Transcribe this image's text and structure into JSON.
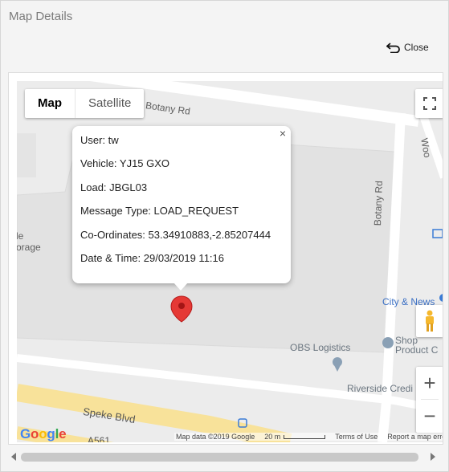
{
  "window": {
    "title": "Map Details",
    "close_label": "Close"
  },
  "map_controls": {
    "map_label": "Map",
    "satellite_label": "Satellite",
    "zoom_in": "+",
    "zoom_out": "−"
  },
  "info_window": {
    "rows": [
      "User: tw",
      "Vehicle: YJ15 GXO",
      "Load: JBGL03",
      "Message Type: LOAD_REQUEST",
      "Co-Ordinates: 53.34910883,-2.85207444",
      "Date & Time: 29/03/2019 11:16"
    ],
    "close_glyph": "×"
  },
  "map_labels": {
    "botany_rd_top": "Botany Rd",
    "botany_rd_side": "Botany Rd",
    "storage": "orage",
    "storage_prefix": "le",
    "city_news": "City & News",
    "obs_logistics": "OBS Logistics",
    "shop": "Shop",
    "product": "Product C",
    "riverside": "Riverside Credi",
    "speke_blvd": "Speke Blvd",
    "a561": "A561",
    "woo": "Woo"
  },
  "attribution": {
    "map_data": "Map data ©2019 Google",
    "scale": "20 m",
    "terms": "Terms of Use",
    "report": "Report a map erro"
  },
  "google_logo": [
    "G",
    "o",
    "o",
    "g",
    "l",
    "e"
  ],
  "colors": {
    "marker": "#e53935",
    "road_major": "#f8e29a",
    "poi_blue": "#4a7bd0"
  }
}
